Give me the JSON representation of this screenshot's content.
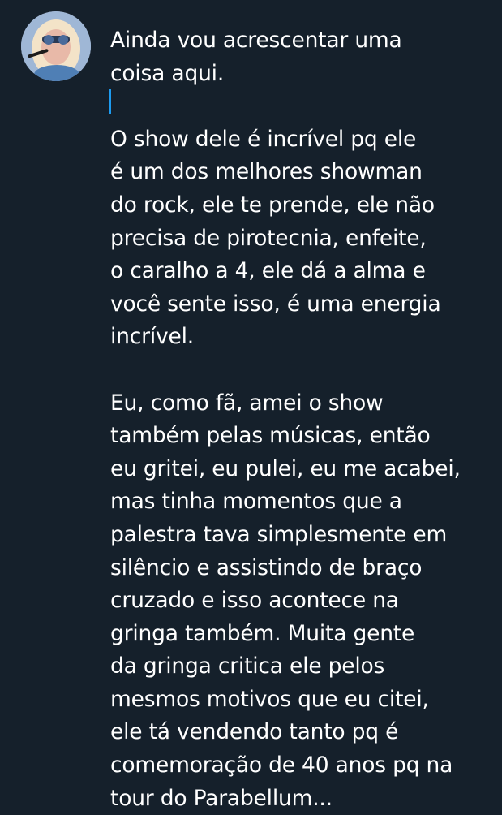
{
  "tweet": {
    "author_avatar": "profile-avatar",
    "paragraphs": [
      {
        "lines": [
          "Ainda vou acrescentar uma",
          "coisa aqui."
        ]
      },
      {
        "lines": [
          "O show dele é incrível pq ele",
          "é um dos melhores showman",
          "do rock, ele te prende, ele não",
          "precisa de pirotecnia, enfeite,",
          "o caralho a 4, ele dá a alma e",
          "você sente isso, é uma energia",
          "incrível."
        ]
      },
      {
        "lines": [
          "Eu, como fã, amei o show",
          "também pelas músicas, então",
          "eu gritei, eu pulei, eu me acabei,",
          "mas tinha momentos que a",
          "palestra tava simplesmente em",
          "silêncio e assistindo de braço",
          "cruzado e isso acontece na",
          "gringa também. Muita gente",
          "da gringa critica ele pelos",
          "mesmos motivos que eu citei,",
          "ele tá vendendo tanto pq é",
          "comemoração de 40 anos pq na",
          "tour do Parabellum..."
        ]
      }
    ]
  },
  "colors": {
    "background": "#15202b",
    "text": "#ffffff",
    "thread_line": "#1d9bf0"
  }
}
